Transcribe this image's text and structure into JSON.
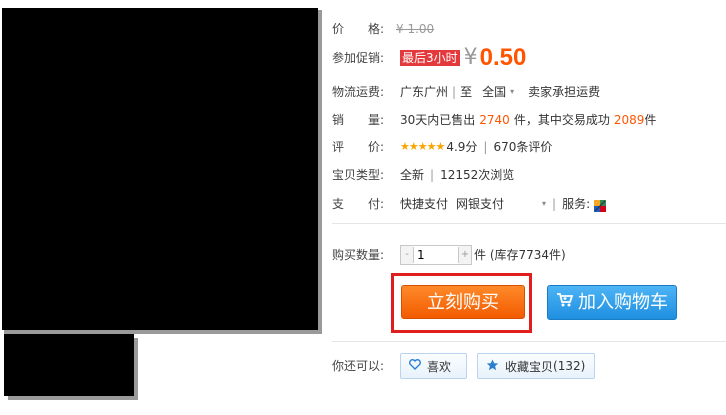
{
  "price": {
    "label": "价　　格:",
    "currency": "¥",
    "original": "1.00"
  },
  "promo": {
    "label": "参加促销:",
    "badge": "最后3小时",
    "currency": "¥",
    "price": "0.50"
  },
  "shipping": {
    "label": "物流运费:",
    "from": "广东广州",
    "to_prefix": "至",
    "to": "全国",
    "note": "卖家承担运费"
  },
  "sales": {
    "label": "销　　量:",
    "prefix": "30天内已售出",
    "sold": "2740",
    "mid": "件，其中交易成功",
    "success": "2089",
    "suffix": "件"
  },
  "rating": {
    "label": "评　　价:",
    "stars": "★★★★★",
    "score": "4.9分",
    "reviews": "670条评价"
  },
  "item_type": {
    "label": "宝贝类型:",
    "condition": "全新",
    "views": "12152次浏览"
  },
  "payment": {
    "label": "支　　付:",
    "method1": "快捷支付",
    "method2": "网银支付",
    "service_label": "服务:"
  },
  "quantity": {
    "label": "购买数量:",
    "minus": "-",
    "value": "1",
    "plus": "+",
    "stock": "件 (库存7734件)"
  },
  "actions": {
    "buy_now": "立刻购买",
    "add_to_cart": "加入购物车"
  },
  "social": {
    "label": "你还可以:",
    "like": "喜欢",
    "collect": "收藏宝贝",
    "collect_count": "(132)"
  },
  "colors": {
    "accent_orange": "#ff5500",
    "promo_red": "#e4393c",
    "cart_blue": "#1f8fe0",
    "highlight_red": "#e01e1e"
  }
}
